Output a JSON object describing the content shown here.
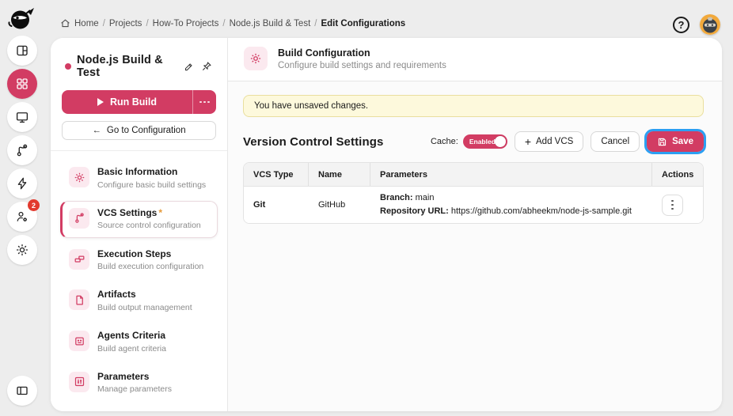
{
  "colors": {
    "accent": "#d23c63",
    "accent_soft": "#fbe9ef",
    "banner_bg": "#fdf9dc",
    "banner_border": "#e9df9e",
    "highlight_ring": "#2b9ff2",
    "badge_red": "#e23a2e",
    "avatar_bg": "#f2a93b",
    "required_asterisk": "#e59a3a"
  },
  "icons": {
    "logo": "ninja-logo",
    "rail": [
      "dashboard-icon",
      "apps-grid-icon",
      "monitor-icon",
      "git-branch-icon",
      "bolt-icon",
      "agents-gear-icon",
      "settings-gear-icon",
      "collapse-sidebar-icon"
    ],
    "topbar": [
      "home-icon",
      "help-icon",
      "ninja-avatar"
    ],
    "sidebar": [
      "edit-pencil-icon",
      "pin-icon",
      "play-icon",
      "ellipsis-icon"
    ],
    "nav": [
      "gear-icon",
      "git-branch-icon",
      "bricks-icon",
      "file-icon",
      "agent-face-icon",
      "sliders-icon"
    ],
    "buttons": [
      "plus-icon",
      "save-floppy-icon",
      "more-vertical-icon"
    ]
  },
  "breadcrumb": {
    "separator": "/",
    "items": [
      "Home",
      "Projects",
      "How-To Projects",
      "Node.js Build & Test",
      "Edit Configurations"
    ]
  },
  "topbar": {
    "help_glyph": "?"
  },
  "rail": {
    "notifications_badge": "2"
  },
  "sidebar": {
    "title": "Node.js Build & Test",
    "run_button": {
      "label": "Run Build"
    },
    "goto_button": {
      "arrow": "←",
      "label": "Go to Configuration"
    },
    "required_mark": "*",
    "nav": [
      {
        "title": "Basic Information",
        "subtitle": "Configure basic build settings"
      },
      {
        "title": "VCS Settings",
        "subtitle": "Source control configuration"
      },
      {
        "title": "Execution Steps",
        "subtitle": "Build execution configuration"
      },
      {
        "title": "Artifacts",
        "subtitle": "Build output management"
      },
      {
        "title": "Agents Criteria",
        "subtitle": "Build agent criteria"
      },
      {
        "title": "Parameters",
        "subtitle": "Manage parameters"
      }
    ]
  },
  "main": {
    "header": {
      "title": "Build Configuration",
      "subtitle": "Configure build settings and requirements"
    },
    "banner": {
      "text": "You have unsaved changes."
    },
    "section": {
      "title": "Version Control Settings",
      "cache_label": "Cache:",
      "cache_state": "Enabled",
      "add_vcs_plus": "+",
      "add_vcs_label": "Add VCS",
      "cancel_label": "Cancel",
      "save_label": "Save"
    },
    "table": {
      "headers": [
        "VCS Type",
        "Name",
        "Parameters",
        "Actions"
      ],
      "rows": [
        {
          "vcs_type": "Git",
          "name": "GitHub",
          "params": [
            {
              "label": "Branch:",
              "value": "main"
            },
            {
              "label": "Repository URL:",
              "value": "https://github.com/abheekm/node-js-sample.git"
            }
          ]
        }
      ]
    }
  }
}
